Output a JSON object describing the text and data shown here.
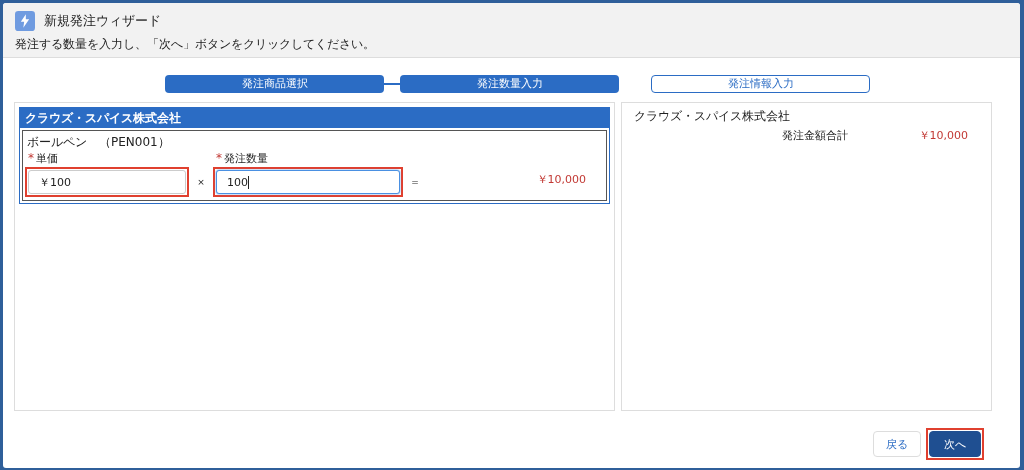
{
  "window": {
    "title": "新規発注ウィザード",
    "instruction": "発注する数量を入力し、「次へ」ボタンをクリックしてください。"
  },
  "steps": [
    {
      "label": "発注商品選択",
      "active": true
    },
    {
      "label": "発注数量入力",
      "active": true
    },
    {
      "label": "発注情報入力",
      "active": false
    }
  ],
  "order_panel": {
    "supplier": "クラウズ・スパイス株式会社",
    "items": [
      {
        "product": "ボールペン　（PEN001）",
        "price_label": "単価",
        "price_required_mark": "*",
        "price": "￥100",
        "price_highlighted": true,
        "times": "×",
        "quantity_label": "発注数量",
        "quantity_required_mark": "*",
        "quantity": "100",
        "quantity_highlighted": true,
        "quantity_focused": true,
        "equals": "=",
        "subtotal": "￥10,000"
      }
    ]
  },
  "summary_panel": {
    "supplier": "クラウズ・スパイス株式会社",
    "total_label": "発注金額合計",
    "total": "￥10,000"
  },
  "buttons": [
    {
      "label": "戻る",
      "kind": "neutral",
      "highlighted": false
    },
    {
      "label": "次へ",
      "kind": "brand",
      "highlighted": true
    }
  ]
}
